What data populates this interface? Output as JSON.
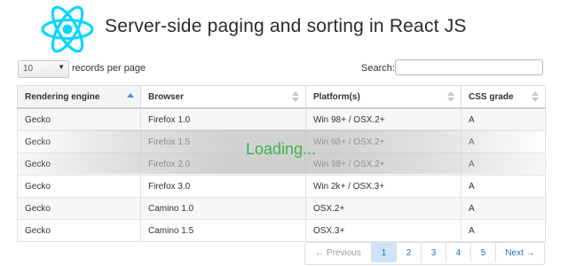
{
  "header": {
    "title": "Server-side paging and sorting in React JS"
  },
  "controls": {
    "page_length": "10",
    "page_length_label": "records per page",
    "search_label": "Search:",
    "search_value": ""
  },
  "table": {
    "columns": [
      {
        "label": "Rendering engine",
        "sort": "asc"
      },
      {
        "label": "Browser",
        "sort": "both"
      },
      {
        "label": "Platform(s)",
        "sort": "both"
      },
      {
        "label": "CSS grade",
        "sort": "both"
      }
    ],
    "rows": [
      [
        "Gecko",
        "Firefox 1.0",
        "Win 98+ / OSX.2+",
        "A"
      ],
      [
        "Gecko",
        "Firefox 1.5",
        "Win 98+ / OSX.2+",
        "A"
      ],
      [
        "Gecko",
        "Firefox 2.0",
        "Win 98+ / OSX.2+",
        "A"
      ],
      [
        "Gecko",
        "Firefox 3.0",
        "Win 2k+ / OSX.3+",
        "A"
      ],
      [
        "Gecko",
        "Camino 1.0",
        "OSX.2+",
        "A"
      ],
      [
        "Gecko",
        "Camino 1.5",
        "OSX.3+",
        "A"
      ]
    ]
  },
  "loading": {
    "text": "Loading..."
  },
  "pagination": {
    "previous": "← Previous",
    "pages": [
      "1",
      "2",
      "3",
      "4",
      "5"
    ],
    "active_page": "1",
    "next": "Next →"
  },
  "colors": {
    "react_logo": "#00d8ff",
    "loading_text": "#3bb54a",
    "link": "#2a6ebb",
    "active_page_bg": "#cfe4f7"
  },
  "icons": {
    "logo": "react-logo-icon",
    "select_caret": "caret-down-icon",
    "sort": "sort-icon"
  }
}
